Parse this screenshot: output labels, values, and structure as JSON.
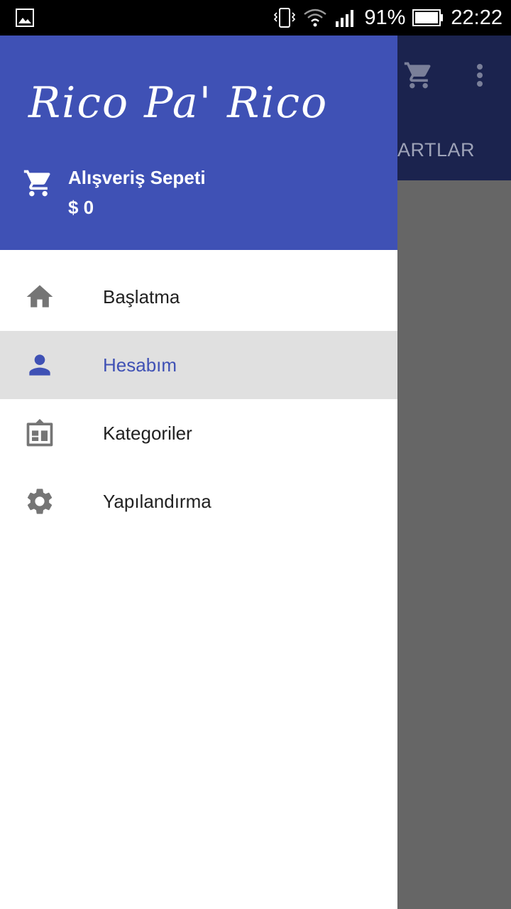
{
  "status_bar": {
    "battery": "91%",
    "time": "22:22"
  },
  "app": {
    "tab_label_partial": "ARTLAR"
  },
  "drawer": {
    "logo": "Rico Pa' Rico",
    "cart": {
      "title": "Alışveriş Sepeti",
      "amount": "$ 0"
    },
    "menu": [
      {
        "label": "Başlatma",
        "icon": "home-icon",
        "selected": false
      },
      {
        "label": "Hesabım",
        "icon": "person-icon",
        "selected": true
      },
      {
        "label": "Kategoriler",
        "icon": "categories-icon",
        "selected": false
      },
      {
        "label": "Yapılandırma",
        "icon": "gear-icon",
        "selected": false
      }
    ]
  },
  "colors": {
    "primary": "#3f51b5",
    "app_bar_dimmed": "#1b234e",
    "selected_bg": "#e0e0e0",
    "icon_gray": "#757575"
  }
}
